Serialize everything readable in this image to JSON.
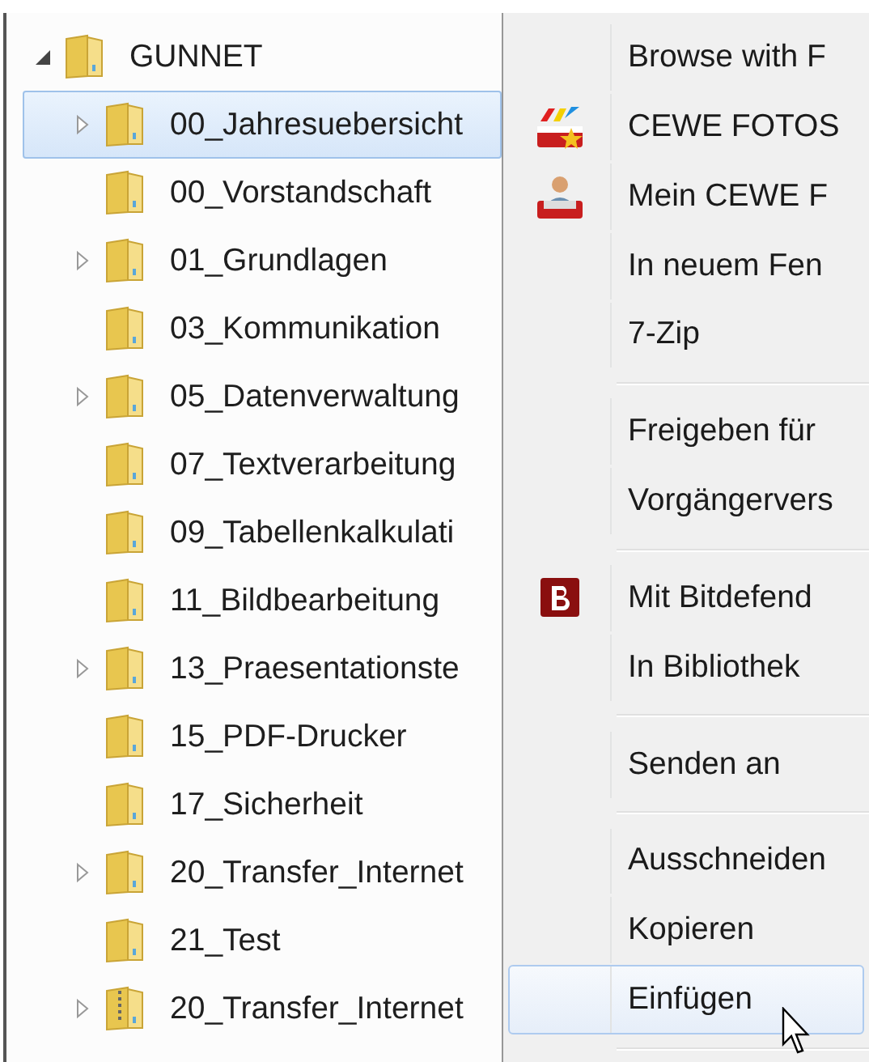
{
  "tree": [
    {
      "label": "GUNNET",
      "kind": "folder",
      "expanded": true,
      "selected": false,
      "children": [
        {
          "label": "00_Jahresuebersicht",
          "kind": "folder",
          "expanded": false,
          "selected": true
        },
        {
          "label": "00_Vorstandschaft",
          "kind": "folder",
          "selected": false
        },
        {
          "label": "01_Grundlagen",
          "kind": "folder",
          "expanded": false,
          "selected": false
        },
        {
          "label": "03_Kommunikation",
          "kind": "folder",
          "selected": false
        },
        {
          "label": "05_Datenverwaltung",
          "kind": "folder",
          "expanded": false,
          "selected": false
        },
        {
          "label": "07_Textverarbeitung",
          "kind": "folder",
          "selected": false
        },
        {
          "label": "09_Tabellenkalkulati",
          "kind": "folder",
          "selected": false
        },
        {
          "label": "11_Bildbearbeitung",
          "kind": "folder",
          "selected": false
        },
        {
          "label": "13_Praesentationste",
          "kind": "folder",
          "expanded": false,
          "selected": false
        },
        {
          "label": "15_PDF-Drucker",
          "kind": "folder",
          "selected": false
        },
        {
          "label": "17_Sicherheit",
          "kind": "folder",
          "selected": false
        },
        {
          "label": "20_Transfer_Internet",
          "kind": "folder",
          "expanded": false,
          "selected": false
        },
        {
          "label": "21_Test",
          "kind": "folder",
          "selected": false
        },
        {
          "label": "20_Transfer_Internet",
          "kind": "zip",
          "expanded": false,
          "selected": false
        }
      ]
    }
  ],
  "context_menu": [
    {
      "kind": "text",
      "label": "Browse with F",
      "selected": false
    },
    {
      "kind": "photo",
      "label": "CEWE FOTOS",
      "selected": false
    },
    {
      "kind": "person",
      "label": "Mein CEWE F",
      "selected": false
    },
    {
      "kind": "text",
      "label": "In neuem Fen",
      "selected": false
    },
    {
      "kind": "text",
      "label": "7-Zip",
      "selected": false
    },
    {
      "kind": "separator"
    },
    {
      "kind": "text",
      "label": "Freigeben für",
      "selected": false
    },
    {
      "kind": "text",
      "label": "Vorgängervers",
      "selected": false
    },
    {
      "kind": "separator"
    },
    {
      "kind": "logo",
      "label": "Mit Bitdefend",
      "selected": false
    },
    {
      "kind": "text",
      "label": "In Bibliothek",
      "selected": false
    },
    {
      "kind": "separator"
    },
    {
      "kind": "text",
      "label": "Senden an",
      "selected": false
    },
    {
      "kind": "separator"
    },
    {
      "kind": "text",
      "label": "Ausschneiden",
      "selected": false
    },
    {
      "kind": "text",
      "label": "Kopieren",
      "selected": false
    },
    {
      "kind": "text",
      "label": "Einfügen",
      "selected": true
    },
    {
      "kind": "separator"
    }
  ]
}
